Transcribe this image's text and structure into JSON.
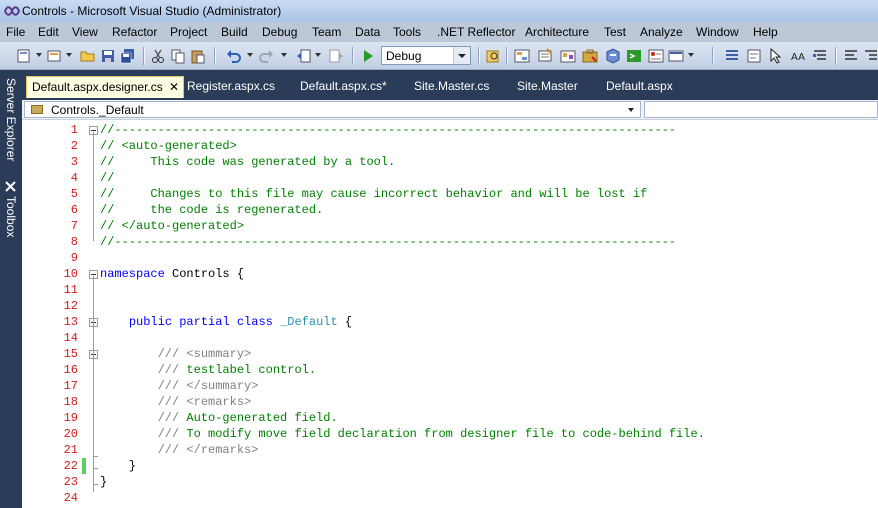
{
  "window": {
    "title": "Controls - Microsoft Visual Studio (Administrator)"
  },
  "menu": [
    "File",
    "Edit",
    "View",
    "Refactor",
    "Project",
    "Build",
    "Debug",
    "Team",
    "Data",
    "Tools",
    ".NET Reflector",
    "Architecture",
    "Test",
    "Analyze",
    "Window",
    "Help"
  ],
  "toolbar": {
    "configuration": "Debug"
  },
  "side_tabs": [
    "Server Explorer",
    "Toolbox"
  ],
  "tabs": [
    {
      "label": "Default.aspx.designer.cs",
      "active": true,
      "close": "✕"
    },
    {
      "label": "Register.aspx.cs"
    },
    {
      "label": "Default.aspx.cs*"
    },
    {
      "label": "Site.Master.cs"
    },
    {
      "label": "Site.Master"
    },
    {
      "label": "Default.aspx"
    }
  ],
  "navigation": {
    "type_selector": "Controls._Default",
    "member_selector": ""
  },
  "code_lines": [
    {
      "n": "1",
      "tokens": [
        {
          "t": "//------------------------------------------------------------------------------",
          "c": "comment"
        }
      ]
    },
    {
      "n": "2",
      "tokens": [
        {
          "t": "// <auto-generated>",
          "c": "comment"
        }
      ]
    },
    {
      "n": "3",
      "tokens": [
        {
          "t": "//     This code was generated by a tool.",
          "c": "comment"
        }
      ]
    },
    {
      "n": "4",
      "tokens": [
        {
          "t": "//",
          "c": "comment"
        }
      ]
    },
    {
      "n": "5",
      "tokens": [
        {
          "t": "//     Changes to this file may cause incorrect behavior and will be lost if",
          "c": "comment"
        }
      ]
    },
    {
      "n": "6",
      "tokens": [
        {
          "t": "//     the code is regenerated.",
          "c": "comment"
        }
      ]
    },
    {
      "n": "7",
      "tokens": [
        {
          "t": "// </auto-generated>",
          "c": "comment"
        }
      ]
    },
    {
      "n": "8",
      "tokens": [
        {
          "t": "//------------------------------------------------------------------------------",
          "c": "comment"
        }
      ]
    },
    {
      "n": "9",
      "tokens": []
    },
    {
      "n": "10",
      "tokens": [
        {
          "t": "namespace",
          "c": "kw"
        },
        {
          "t": " Controls {",
          "c": "plain"
        }
      ]
    },
    {
      "n": "11",
      "tokens": []
    },
    {
      "n": "12",
      "tokens": []
    },
    {
      "n": "13",
      "tokens": [
        {
          "t": "    ",
          "c": "plain"
        },
        {
          "t": "public",
          "c": "kw"
        },
        {
          "t": " ",
          "c": "plain"
        },
        {
          "t": "partial",
          "c": "kw"
        },
        {
          "t": " ",
          "c": "plain"
        },
        {
          "t": "class",
          "c": "kw"
        },
        {
          "t": " ",
          "c": "plain"
        },
        {
          "t": "_Default",
          "c": "type"
        },
        {
          "t": " {",
          "c": "plain"
        }
      ]
    },
    {
      "n": "14",
      "tokens": []
    },
    {
      "n": "15",
      "tokens": [
        {
          "t": "        /// ",
          "c": "doc"
        },
        {
          "t": "<summary>",
          "c": "doc"
        }
      ]
    },
    {
      "n": "16",
      "tokens": [
        {
          "t": "        /// ",
          "c": "doc"
        },
        {
          "t": "testlabel control.",
          "c": "comment"
        }
      ]
    },
    {
      "n": "17",
      "tokens": [
        {
          "t": "        /// ",
          "c": "doc"
        },
        {
          "t": "</summary>",
          "c": "doc"
        }
      ]
    },
    {
      "n": "18",
      "tokens": [
        {
          "t": "        /// ",
          "c": "doc"
        },
        {
          "t": "<remarks>",
          "c": "doc"
        }
      ]
    },
    {
      "n": "19",
      "tokens": [
        {
          "t": "        /// ",
          "c": "doc"
        },
        {
          "t": "Auto-generated field.",
          "c": "comment"
        }
      ]
    },
    {
      "n": "20",
      "tokens": [
        {
          "t": "        /// ",
          "c": "doc"
        },
        {
          "t": "To modify move field declaration from designer file to code-behind file.",
          "c": "comment"
        }
      ]
    },
    {
      "n": "21",
      "tokens": [
        {
          "t": "        /// ",
          "c": "doc"
        },
        {
          "t": "</remarks>",
          "c": "doc"
        }
      ]
    },
    {
      "n": "22",
      "tokens": [
        {
          "t": "    }",
          "c": "plain"
        }
      ]
    },
    {
      "n": "23",
      "tokens": [
        {
          "t": "}",
          "c": "plain"
        }
      ]
    },
    {
      "n": "24",
      "tokens": []
    }
  ],
  "icons": {
    "toolbar": [
      "new-project-icon",
      "add-item-icon",
      "open-file-icon",
      "save-icon",
      "save-all-icon",
      "cut-icon",
      "copy-icon",
      "paste-icon",
      "undo-icon",
      "redo-icon",
      "navigate-backward-icon",
      "navigate-forward-icon",
      "start-debugging-icon",
      "find-in-files-icon",
      "solution-explorer-icon",
      "properties-icon",
      "object-browser-icon",
      "toolbox-icon",
      "start-page-icon",
      "command-window-icon",
      "error-list-icon",
      "pointer-icon",
      "font-icon",
      "comment-icon",
      "uncomment-icon"
    ]
  }
}
